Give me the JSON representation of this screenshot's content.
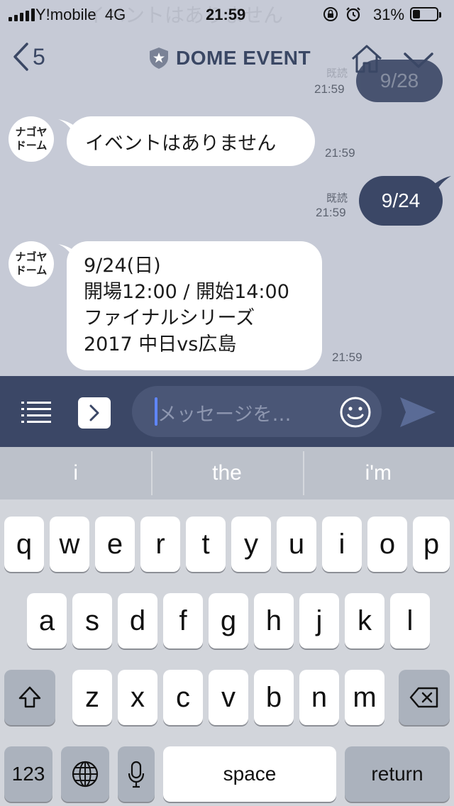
{
  "status_bar": {
    "carrier": "Y!mobile",
    "network": "4G",
    "time": "21:59",
    "battery_percent": "31%",
    "battery_level": 0.31
  },
  "header": {
    "back_count": "5",
    "title": "DOME EVENT"
  },
  "messages": {
    "prev_outgoing": "9/28",
    "prev_read": "既読",
    "prev_time": "21:59",
    "ghost_text": "イベントはありません",
    "bot_name": "ナゴヤドーム",
    "bot_name_line1": "ナゴヤ",
    "bot_name_line2": "ドーム",
    "msg1_text": "イベントはありません",
    "msg1_time": "21:59",
    "msg2_text": "9/24",
    "msg2_read": "既読",
    "msg2_time": "21:59",
    "msg3_line1": "9/24(日)",
    "msg3_line2": "開場12:00 / 開始14:00",
    "msg3_line3": "ファイナルシリーズ",
    "msg3_line4": "2017 中日vs広島",
    "msg3_time": "21:59"
  },
  "input": {
    "placeholder": "メッセージを…"
  },
  "keyboard": {
    "suggestions": [
      "i",
      "the",
      "i'm"
    ],
    "row1": [
      "q",
      "w",
      "e",
      "r",
      "t",
      "y",
      "u",
      "i",
      "o",
      "p"
    ],
    "row2": [
      "a",
      "s",
      "d",
      "f",
      "g",
      "h",
      "j",
      "k",
      "l"
    ],
    "row3": [
      "z",
      "x",
      "c",
      "v",
      "b",
      "n",
      "m"
    ],
    "numbers_key": "123",
    "space_key": "space",
    "return_key": "return"
  },
  "colors": {
    "chat_bg": "#c6cad6",
    "accent": "#3b4766",
    "cursor": "#5f86ff"
  },
  "icons": [
    "back-chevron-icon",
    "shield-star-icon",
    "home-icon",
    "chevron-down-icon",
    "menu-list-icon",
    "chevron-right-icon",
    "smiley-icon",
    "send-icon",
    "shift-icon",
    "delete-icon",
    "globe-icon",
    "microphone-icon"
  ]
}
